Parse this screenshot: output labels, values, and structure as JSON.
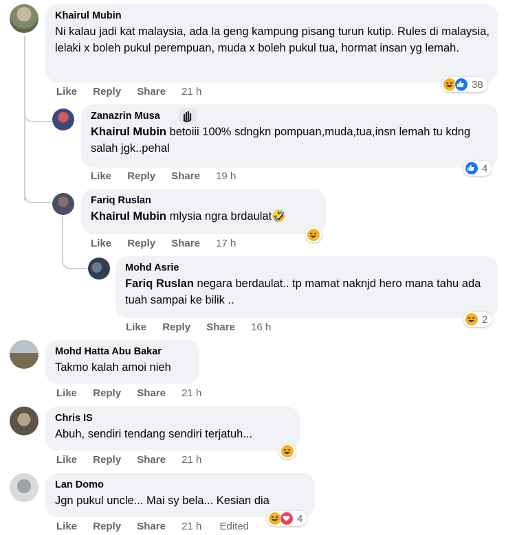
{
  "comments": [
    {
      "author": "Khairul Mubin",
      "text": "Ni kalau jadi kat malaysia, ada la geng kampung pisang turun kutip. Rules di malaysia, lelaki x boleh pukul perempuan, muda x boleh pukul tua, hormat insan yg lemah.",
      "actions": [
        "Like",
        "Reply",
        "Share"
      ],
      "time": "21 h",
      "reactions": [
        "haha",
        "like"
      ],
      "reaction_count": "38"
    },
    {
      "author": "Zanazrin Musa",
      "badge_icon": "waving-hand-icon",
      "mention": "Khairul Mubin",
      "text": " betoiii 100% sdngkn pompuan,muda,tua,insn lemah tu kdng salah jgk..pehal",
      "actions": [
        "Like",
        "Reply",
        "Share"
      ],
      "time": "19 h",
      "reactions": [
        "like"
      ],
      "reaction_count": "4"
    },
    {
      "author": "Fariq Ruslan",
      "mention": "Khairul Mubin",
      "text": " mlysia ngra brdaulat🤣",
      "actions": [
        "Like",
        "Reply",
        "Share"
      ],
      "time": "17 h",
      "reactions": [
        "haha"
      ]
    },
    {
      "author": "Mohd Asrie",
      "mention": "Fariq Ruslan",
      "text": " negara berdaulat.. tp mamat naknjd hero mana tahu ada tuah sampai ke bilik ..",
      "actions": [
        "Like",
        "Reply",
        "Share"
      ],
      "time": "16 h",
      "reactions": [
        "haha"
      ],
      "reaction_count": "2"
    },
    {
      "author": "Mohd Hatta Abu Bakar",
      "text": "Takmo kalah amoi nieh",
      "actions": [
        "Like",
        "Reply",
        "Share"
      ],
      "time": "21 h"
    },
    {
      "author": "Chris IS",
      "text": "Abuh, sendiri tendang sendiri terjatuh...",
      "actions": [
        "Like",
        "Reply",
        "Share"
      ],
      "time": "21 h",
      "reactions": [
        "haha"
      ]
    },
    {
      "author": "Lan Domo",
      "text": "Jgn pukul uncle... Mai sy bela... Kesian dia",
      "actions": [
        "Like",
        "Reply",
        "Share"
      ],
      "time": "21 h",
      "edited": "Edited",
      "reactions": [
        "haha",
        "love"
      ],
      "reaction_count": "4"
    }
  ],
  "colors": {
    "bubble": "#f0f2f5",
    "meta_text": "#65676b",
    "like": "#1877f2",
    "haha": "#f7b125",
    "love": "#f33e58",
    "thread_line": "#ced0d4"
  }
}
